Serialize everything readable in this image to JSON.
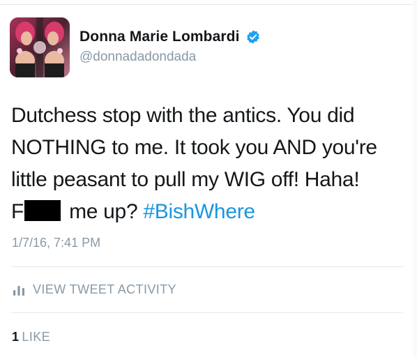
{
  "tweet": {
    "author": {
      "display_name": "Donna Marie Lombardi",
      "handle": "@donnadadondada",
      "verified": true,
      "avatar_icon": "profile-photo"
    },
    "text_lines": [
      "Dutchess stop with the antics. You did",
      "NOTHING to me. It took you AND you're",
      "little peasant to pull my WIG off! Haha!"
    ],
    "last_line": {
      "prefix": "F",
      "suffix": " me up? ",
      "hashtag": "#BishWhere"
    },
    "timestamp": "1/7/16, 7:41 PM",
    "activity_label": "VIEW TWEET ACTIVITY",
    "likes": {
      "count": "1",
      "label": "LIKE"
    }
  },
  "colors": {
    "text": "#14171a",
    "secondary": "#8899a6",
    "link": "#1b95e0",
    "verified": "#1da1f2",
    "divider": "#e1e8ed"
  }
}
